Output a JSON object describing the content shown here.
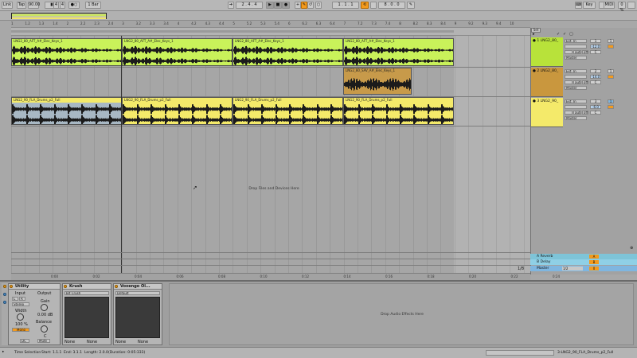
{
  "transport": {
    "link": "Link",
    "tap": "Tap",
    "tempo": "90.00",
    "sig_num": "4",
    "sig_den": "4",
    "metro": "1 Bar",
    "position": "2 . 4 . 4",
    "loop_start": "1 . 1 . 1",
    "loop_len": "8 . 0 . 0",
    "key": "Key",
    "midi": "MIDI",
    "cpu": "0 %"
  },
  "ruler_ticks": [
    "1",
    "1.2",
    "1.3",
    "1.4",
    "2",
    "2.2",
    "2.3",
    "2.4",
    "3",
    "3.2",
    "3.3",
    "3.4",
    "4",
    "4.2",
    "4.3",
    "4.4",
    "5",
    "5.2",
    "5.3",
    "5.4",
    "6",
    "6.2",
    "6.3",
    "6.4",
    "7",
    "7.2",
    "7.3",
    "7.4",
    "8",
    "8.2",
    "8.3",
    "8.4",
    "9",
    "9.2",
    "9.3",
    "9.4",
    "10"
  ],
  "time_ticks": [
    "0:00",
    "0:02",
    "0:04",
    "0:06",
    "0:08",
    "0:10",
    "0:12",
    "0:14",
    "0:16",
    "0:18",
    "0:20",
    "0:22",
    "0:24"
  ],
  "drop_files": "Drop Files and Devices Here",
  "drop_effects": "Drop Audio Effects Here",
  "page_indicator": "1/8",
  "clips": {
    "keys": [
      "LNG2_80_AFT_A#_Elec_Keys_1",
      "LNG2_80_AFT_A#_Elec_Keys_1",
      "LNG2_80_AFT_A#_Elec_Keys_1",
      "LNG2_80_AFT_A#_Elec_Keys_1"
    ],
    "sav": "LNG2_80_SAV_A#_Elec_Keys_1",
    "drums": [
      "LNG2_90_FLA_Drums_p2_Full",
      "LNG2_90_FLA_Drums_p2_Full",
      "LNG2_90_FLA_Drums_p2_Full",
      "LNG2_90_FLA_Drums_p2_Full"
    ]
  },
  "tracks": [
    {
      "name": "1 LNG2_80_",
      "input": "Ext. In",
      "ch": "1",
      "vol": "-12.0",
      "pan": "C",
      "num": "1",
      "out": "Master",
      "color": "#b8e23a"
    },
    {
      "name": "2 LNG2_80_",
      "input": "Ext. In",
      "ch": "1",
      "vol": "-14.0",
      "pan": "C",
      "num": "2",
      "out": "Master",
      "color": "#c9973e"
    },
    {
      "name": "3 LNG2_90_",
      "input": "Ext. In",
      "ch": "1",
      "vol": "-6.0",
      "pan": "C",
      "num": "3",
      "out": "Master",
      "color": "#f4ea6a"
    }
  ],
  "set_label": "Set",
  "auto_label": "auto",
  "off_label": "off",
  "returns": [
    {
      "name": "A Reverb",
      "letter": "A",
      "color": "#7ec4d8"
    },
    {
      "name": "B Delay",
      "letter": "B",
      "color": "#8fd0e6"
    },
    {
      "name": "Master",
      "letter": "0",
      "color": "#7fb6e0",
      "sel": "1/2"
    }
  ],
  "devices": {
    "utility": {
      "title": "Utility",
      "input": "Input",
      "output": "Output",
      "stereo": "Stereo",
      "gain": "Gain",
      "gain_val": "0.00 dB",
      "width": "Width",
      "width_val": "100 %",
      "mono": "Mono",
      "balance": "Balance",
      "balance_val": "C",
      "mute": "Mute",
      "dc": "DC",
      "l": "L",
      "r": "R"
    },
    "krush": {
      "title": "Krush",
      "preset": "Bit Crush",
      "footer_a": "None",
      "footer_b": "None"
    },
    "voxengo": {
      "title": "Voxengo Ol...",
      "preset": "Default",
      "footer_a": "None",
      "footer_b": "None"
    }
  },
  "status": {
    "selection": "Time Selection",
    "start": "Start: 1.1.1",
    "end": "End: 3.1.1",
    "length": "Length: 2.0.0",
    "duration": "(Duration: 0:05:333)",
    "track": "3-LNG2_90_FLA_Drums_p2_Full"
  }
}
